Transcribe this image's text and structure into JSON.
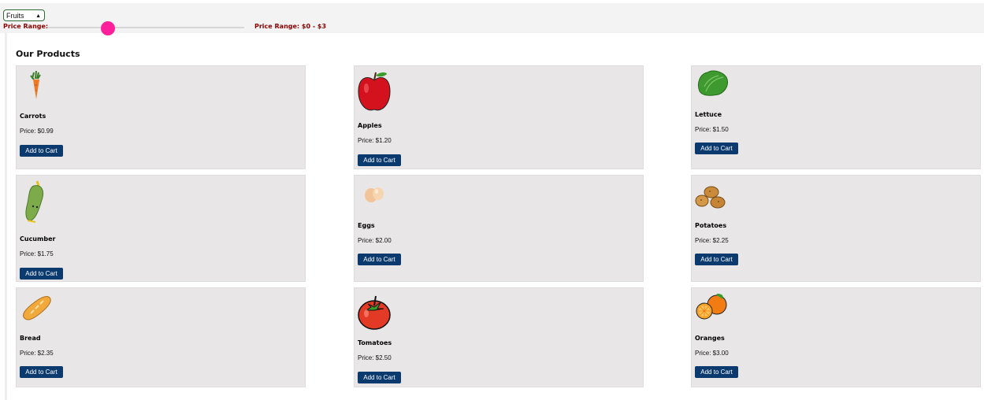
{
  "filters": {
    "category_selected": "Fruits",
    "price_range_label": "Price Range:",
    "price_range_display": "Price Range: $0 - $3",
    "slider_value_fraction": 0.27
  },
  "products_heading": "Our Products",
  "add_to_cart_label": "Add to Cart",
  "products": [
    {
      "name": "Carrots",
      "price": "Price: $0.99",
      "icon": "carrot-icon"
    },
    {
      "name": "Apples",
      "price": "Price: $1.20",
      "icon": "apple-icon"
    },
    {
      "name": "Lettuce",
      "price": "Price: $1.50",
      "icon": "lettuce-icon"
    },
    {
      "name": "Cucumber",
      "price": "Price: $1.75",
      "icon": "cucumber-icon"
    },
    {
      "name": "Eggs",
      "price": "Price: $2.00",
      "icon": "eggs-icon"
    },
    {
      "name": "Potatoes",
      "price": "Price: $2.25",
      "icon": "potatoes-icon"
    },
    {
      "name": "Bread",
      "price": "Price: $2.35",
      "icon": "bread-icon"
    },
    {
      "name": "Tomatoes",
      "price": "Price: $2.50",
      "icon": "tomato-icon"
    },
    {
      "name": "Oranges",
      "price": "Price: $3.00",
      "icon": "oranges-icon"
    }
  ],
  "colors": {
    "accent_pink": "#ff1f9a",
    "button_navy": "#0b3a6e",
    "label_red": "#8b0000",
    "card_bg": "#e8e6e7"
  }
}
